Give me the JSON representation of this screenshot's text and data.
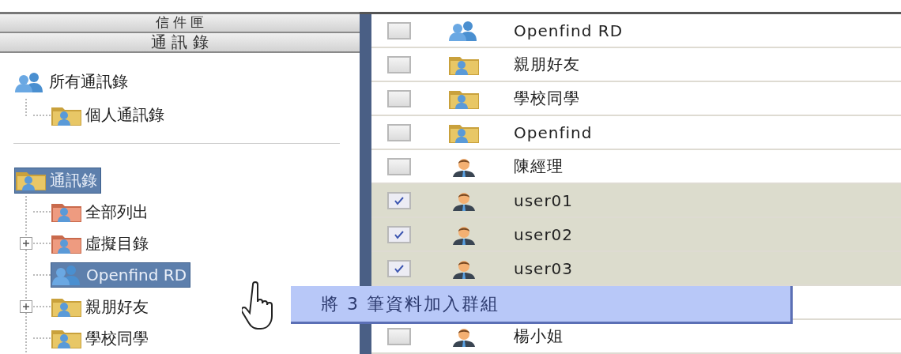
{
  "sidebar": {
    "headers": [
      {
        "label": "信 件 匣"
      },
      {
        "label": "通 訊 錄"
      }
    ],
    "trees": [
      [
        {
          "label": "所有通訊錄",
          "kind": "group",
          "selected": false,
          "children": [
            {
              "label": "個人通訊錄",
              "kind": "folder",
              "selected": false,
              "expandable": false
            }
          ]
        }
      ],
      [
        {
          "label": "通訊錄",
          "kind": "folder",
          "selected": true,
          "children": [
            {
              "label": "全部列出",
              "kind": "system",
              "selected": false,
              "expandable": false
            },
            {
              "label": "虛擬目錄",
              "kind": "system",
              "selected": false,
              "expandable": true
            },
            {
              "label": "Openfind RD",
              "kind": "group",
              "selected": true,
              "expandable": false
            },
            {
              "label": "親朋好友",
              "kind": "folder",
              "selected": false,
              "expandable": true
            },
            {
              "label": "學校同學",
              "kind": "folder",
              "selected": false,
              "expandable": false
            }
          ]
        }
      ]
    ]
  },
  "list": {
    "rows": [
      {
        "kind": "group",
        "name": "Openfind RD",
        "checked": false
      },
      {
        "kind": "folder",
        "name": "親朋好友",
        "checked": false
      },
      {
        "kind": "folder",
        "name": "學校同學",
        "checked": false
      },
      {
        "kind": "folder",
        "name": "Openfind",
        "checked": false
      },
      {
        "kind": "person",
        "name": "陳經理",
        "checked": false
      },
      {
        "kind": "person",
        "name": "user01",
        "checked": true
      },
      {
        "kind": "person",
        "name": "user02",
        "checked": true
      },
      {
        "kind": "person",
        "name": "user03",
        "checked": true
      },
      {
        "kind": "covered"
      },
      {
        "kind": "person",
        "name": "楊小姐",
        "checked": false
      }
    ]
  },
  "drag_tooltip": {
    "text": "將 3 筆資料加入群組"
  }
}
